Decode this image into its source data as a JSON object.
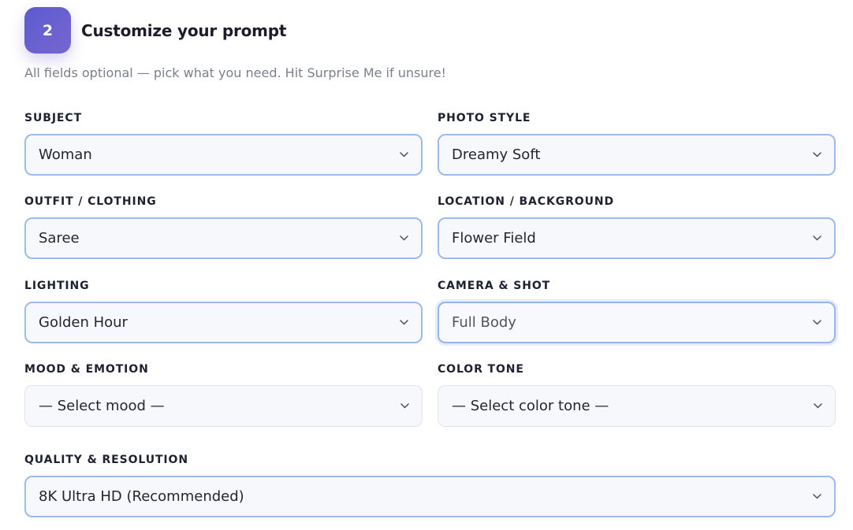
{
  "step": {
    "number": "2",
    "title": "Customize your prompt",
    "subtitle": "All fields optional — pick what you need. Hit Surprise Me if unsure!"
  },
  "fields": {
    "subject": {
      "label": "SUBJECT",
      "value": "Woman"
    },
    "photo_style": {
      "label": "PHOTO STYLE",
      "value": "Dreamy Soft"
    },
    "outfit": {
      "label": "OUTFIT / CLOTHING",
      "value": "Saree"
    },
    "location": {
      "label": "LOCATION / BACKGROUND",
      "value": "Flower Field"
    },
    "lighting": {
      "label": "LIGHTING",
      "value": "Golden Hour"
    },
    "camera": {
      "label": "CAMERA & SHOT",
      "value": "Full Body"
    },
    "mood": {
      "label": "MOOD & EMOTION",
      "value": "— Select mood —"
    },
    "color_tone": {
      "label": "COLOR TONE",
      "value": "— Select color tone —"
    },
    "quality": {
      "label": "QUALITY & RESOLUTION",
      "value": "8K Ultra HD (Recommended)"
    }
  },
  "colors": {
    "accent": "#6b63d4",
    "selected_border": "#9ebaea",
    "empty_border": "#e0e3ea"
  },
  "icons": {
    "dropdown": "chevron-down-icon"
  }
}
